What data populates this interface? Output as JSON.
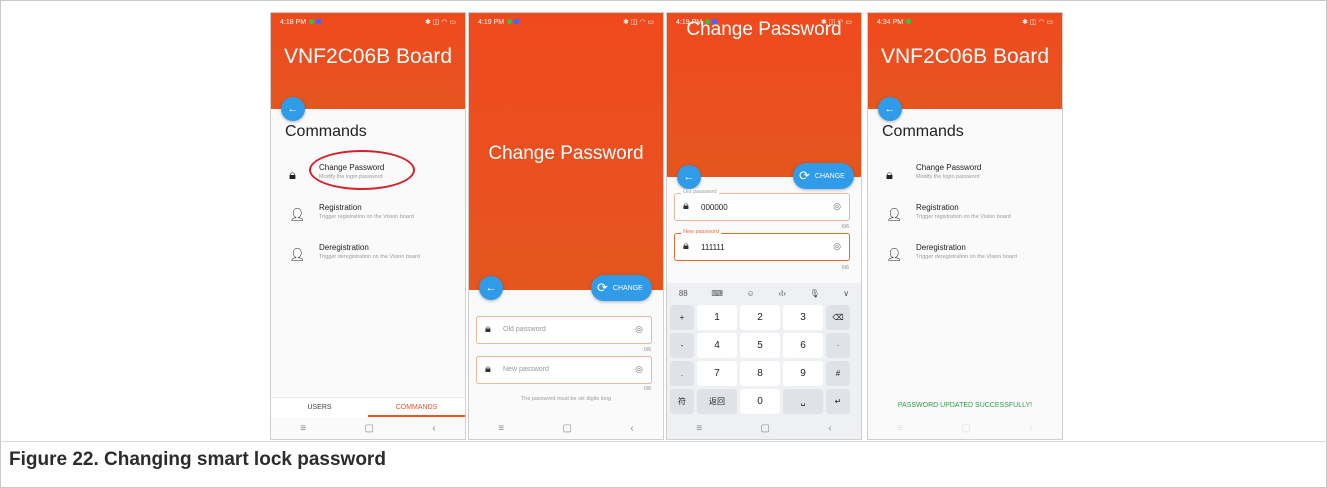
{
  "caption": "Figure 22.  Changing smart lock password",
  "phones": {
    "p1": {
      "time": "4:18 PM",
      "title": "VNF2C06B Board",
      "section": "Commands",
      "commands": [
        {
          "label": "Change Password",
          "sub": "Modify the login password"
        },
        {
          "label": "Registration",
          "sub": "Trigger registration on the Vision board"
        },
        {
          "label": "Deregistration",
          "sub": "Trigger deregistration on the Vision board"
        }
      ],
      "tabs": [
        "USERS",
        "COMMANDS"
      ]
    },
    "p2": {
      "time": "4:19 PM",
      "title": "Change Password",
      "change_label": "CHANGE",
      "old_placeholder": "Old password",
      "new_placeholder": "New password",
      "old_counter": "0/6",
      "new_counter": "0/6",
      "hint": "The password must be six digits long"
    },
    "p3": {
      "time": "4:19 PM",
      "title": "Change Password",
      "change_label": "CHANGE",
      "old_legend": "Old password",
      "new_legend": "New password",
      "old_value": "000000",
      "new_value": "111111",
      "old_counter": "6/6",
      "new_counter": "6/6",
      "kb_top": [
        "88",
        "⌨",
        "☺",
        "‹I›",
        "🎙",
        "∨"
      ],
      "keys": [
        "+",
        "1",
        "2",
        "3",
        "⌫",
        "-",
        "4",
        "5",
        "6",
        "·",
        ".",
        "7",
        "8",
        "9",
        "#",
        "符",
        "返回",
        "0",
        "␣",
        "↵"
      ]
    },
    "p4": {
      "time": "4:34 PM",
      "title": "VNF2C06B Board",
      "section": "Commands",
      "commands": [
        {
          "label": "Change Password",
          "sub": "Modify the login password"
        },
        {
          "label": "Registration",
          "sub": "Trigger registration on the Vision board"
        },
        {
          "label": "Deregistration",
          "sub": "Trigger deregistration on the Vision board"
        }
      ],
      "success": "PASSWORD UPDATED SUCCESSFULLY!"
    }
  },
  "colors": {
    "header": "#ea5020",
    "fab": "#2f9be9",
    "accent": "#e8552a",
    "success": "#2e9e4a",
    "annotation": "#d4202a"
  },
  "icons": {
    "back": "arrow-left-icon",
    "change": "refresh-icon",
    "lock": "lock-icon",
    "eye": "eye-off-icon",
    "user_add": "person-add-icon",
    "user_remove": "person-remove-icon"
  }
}
